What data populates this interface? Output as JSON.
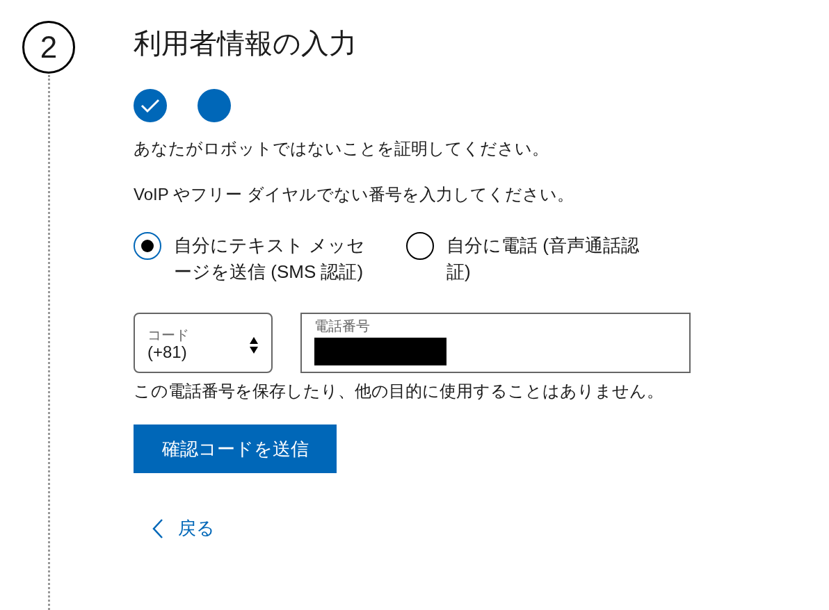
{
  "step_number": "2",
  "title": "利用者情報の入力",
  "progress": [
    {
      "completed": true
    },
    {
      "completed": false
    }
  ],
  "instruction": "あなたがロボットではないことを証明してください。",
  "hint": "VoIP やフリー ダイヤルでない番号を入力してください。",
  "options": [
    {
      "label": "自分にテキスト メッセージを送信 (SMS 認証)",
      "selected": true
    },
    {
      "label": "自分に電話 (音声通話認証)",
      "selected": false
    }
  ],
  "code_field": {
    "label": "コード",
    "value": "(+81)"
  },
  "phone_field": {
    "label": "電話番号",
    "redacted": true
  },
  "privacy_note": "この電話番号を保存したり、他の目的に使用することはありません。",
  "send_button": "確認コードを送信",
  "back_link": "戻る"
}
